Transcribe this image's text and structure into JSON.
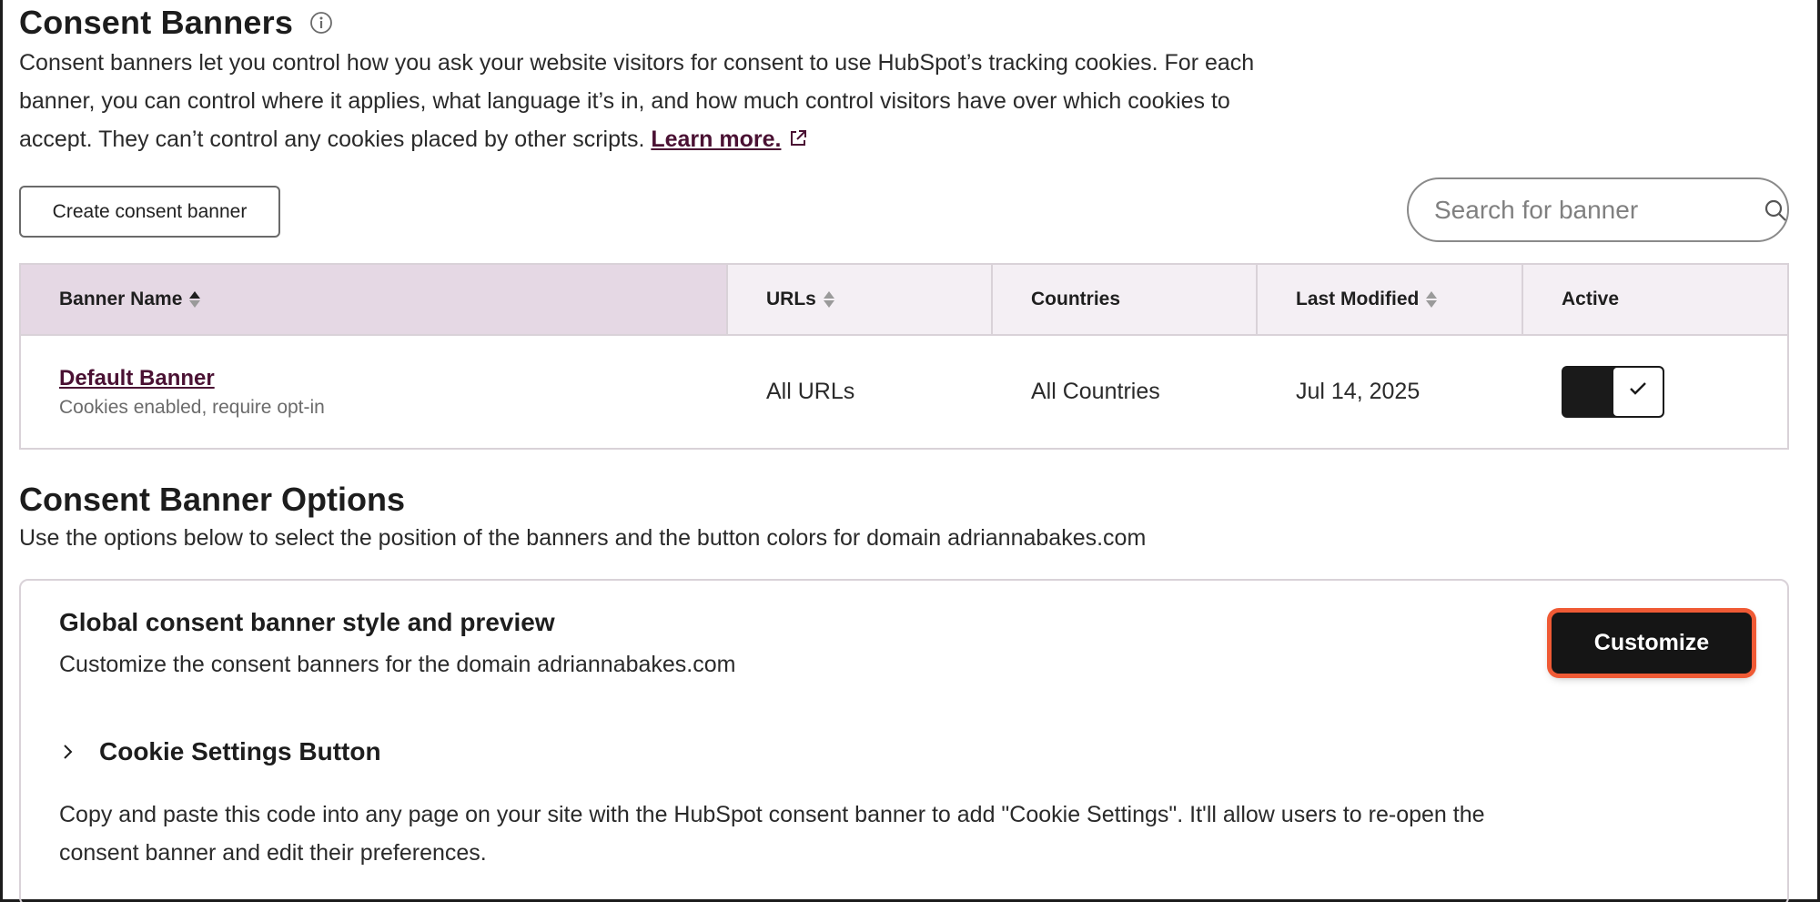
{
  "header": {
    "title": "Consent Banners",
    "intro_text": "Consent banners let you control how you ask your website visitors for consent to use HubSpot’s tracking cookies. For each banner, you can control where it applies, what language it’s in, and how much control visitors have over which cookies to accept. They can’t control any cookies placed by other scripts.",
    "learn_more": "Learn more."
  },
  "toolbar": {
    "create_label": "Create consent banner",
    "search_placeholder": "Search for banner"
  },
  "table": {
    "columns": [
      "Banner Name",
      "URLs",
      "Countries",
      "Last Modified",
      "Active"
    ],
    "rows": [
      {
        "name": "Default Banner",
        "subtitle": "Cookies enabled, require opt-in",
        "urls": "All URLs",
        "countries": "All Countries",
        "last_modified": "Jul 14, 2025",
        "active": true
      }
    ]
  },
  "options": {
    "title": "Consent Banner Options",
    "subtitle": "Use the options below to select the position of the banners and the button colors for domain adriannabakes.com"
  },
  "card": {
    "title": "Global consent banner style and preview",
    "subtitle": "Customize the consent banners for the domain adriannabakes.com",
    "customize_label": "Customize",
    "cookie_title": "Cookie Settings Button",
    "cookie_desc": "Copy and paste this code into any page on your site with the HubSpot consent banner to add \"Cookie Settings\". It'll allow users to re-open the consent banner and edit their preferences."
  },
  "colors": {
    "link": "#4a1133",
    "header_bg": "#f4eff4",
    "sorted_header_bg": "#e5d8e4",
    "highlight": "#ef5a35",
    "button_dark": "#151515"
  },
  "icons": {
    "info": "info-icon",
    "external": "external-link-icon",
    "search": "search-icon",
    "sort": "sort-icon",
    "check": "check-icon",
    "chevron": "chevron-right-icon"
  }
}
